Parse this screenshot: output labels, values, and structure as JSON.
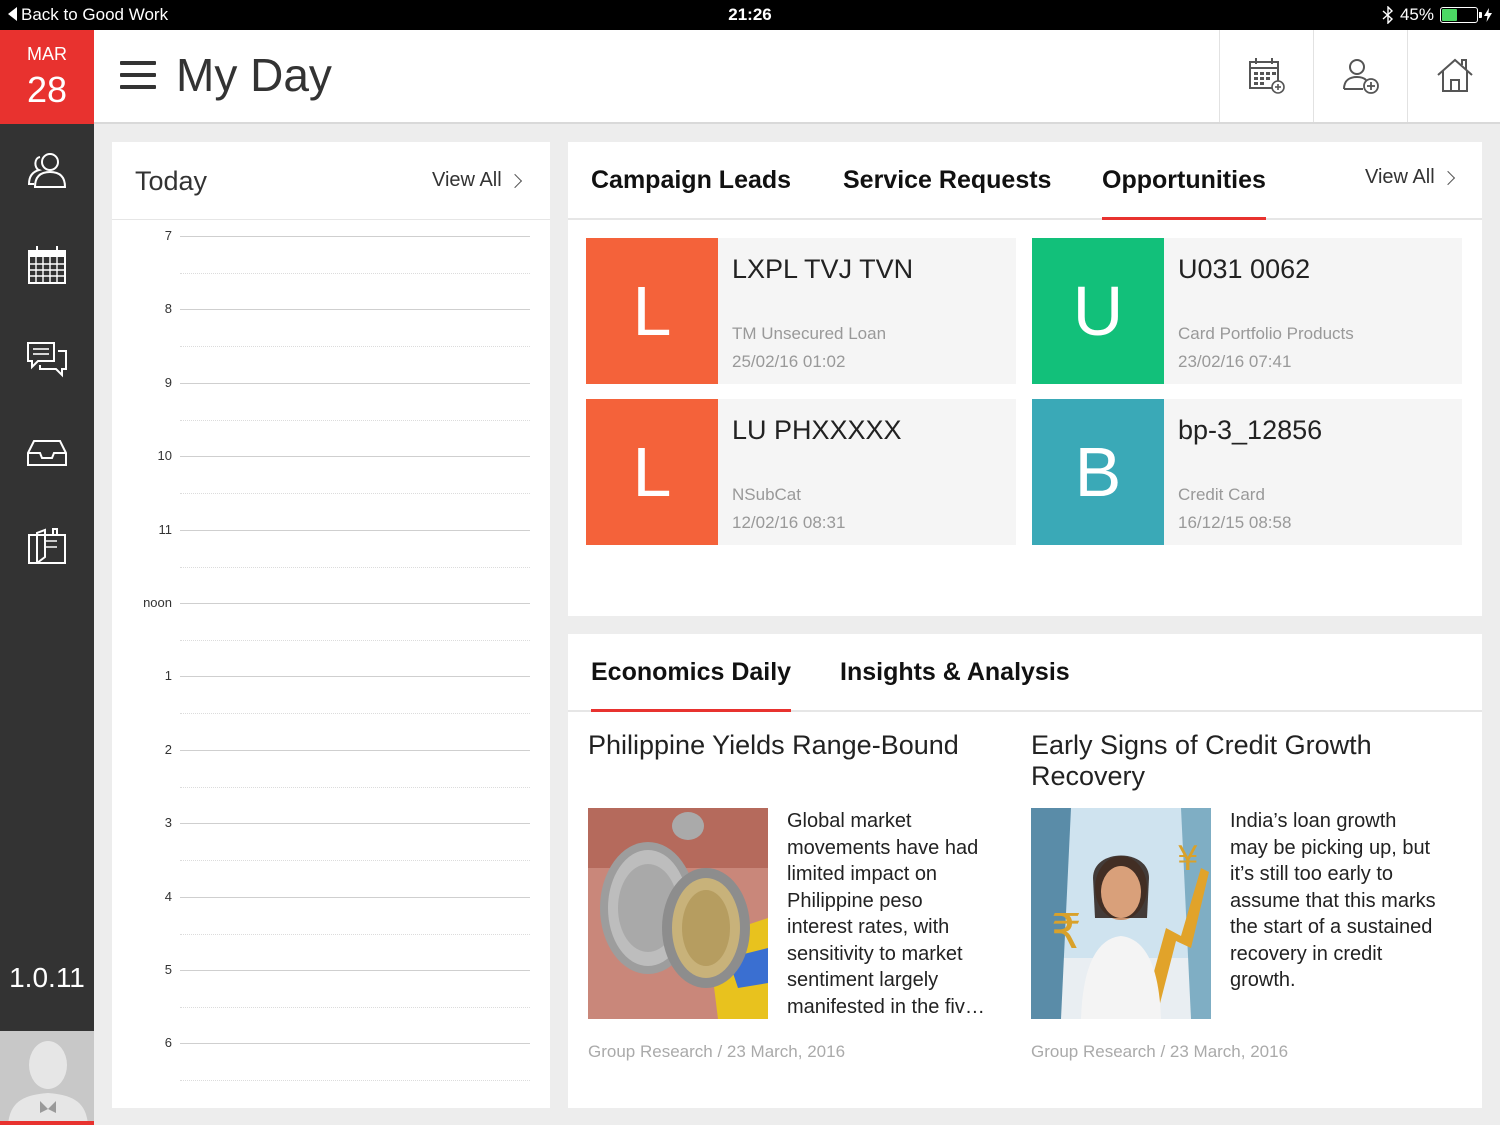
{
  "status_bar": {
    "back_label": "Back to Good Work",
    "time": "21:26",
    "battery": "45%",
    "battery_level": 0.45
  },
  "date": {
    "month": "MAR",
    "day": "28"
  },
  "header": {
    "title": "My Day"
  },
  "sidebar": {
    "version": "1.0.11"
  },
  "today": {
    "title": "Today",
    "view_all": "View All",
    "hours": [
      "7",
      "8",
      "9",
      "10",
      "11",
      "noon",
      "1",
      "2",
      "3",
      "4",
      "5",
      "6"
    ]
  },
  "leads": {
    "tabs": [
      "Campaign Leads",
      "Service Requests",
      "Opportunities"
    ],
    "active_tab": "Opportunities",
    "view_all": "View All",
    "cards": [
      {
        "letter": "L",
        "name": "LXPL TVJ TVN",
        "subtitle": "TM Unsecured Loan",
        "timestamp": "25/02/16 01:02",
        "color": "#f4623a"
      },
      {
        "letter": "U",
        "name": "U031 0062",
        "subtitle": "Card Portfolio Products",
        "timestamp": "23/02/16 07:41",
        "color": "#12c07a"
      },
      {
        "letter": "L",
        "name": "LU PHXXXXX",
        "subtitle": "NSubCat",
        "timestamp": "12/02/16 08:31",
        "color": "#f4623a"
      },
      {
        "letter": "B",
        "name": "bp-3_12856",
        "subtitle": "Credit Card",
        "timestamp": "16/12/15 08:58",
        "color": "#3aa9b7"
      }
    ]
  },
  "news": {
    "tabs": [
      "Economics Daily",
      "Insights & Analysis"
    ],
    "active_tab": "Economics Daily",
    "articles": [
      {
        "title": "Philippine Yields Range-Bound",
        "body_lines": [
          "Global market",
          "movements have had",
          "limited impact on",
          "Philippine peso",
          "interest rates, with",
          "sensitivity to market",
          "sentiment largely",
          "manifested in the fiv…"
        ],
        "meta": "Group Research / 23 March, 2016"
      },
      {
        "title": "Early Signs of Credit Growth Recovery",
        "body_lines": [
          "India’s loan growth",
          "may be picking up, but",
          "it’s still too early to",
          "assume that this marks",
          "the start of a sustained",
          "recovery in credit",
          "growth."
        ],
        "meta": "Group Research / 23 March, 2016"
      }
    ]
  },
  "colors": {
    "accent": "#e8322f",
    "sidebar": "#333333"
  }
}
